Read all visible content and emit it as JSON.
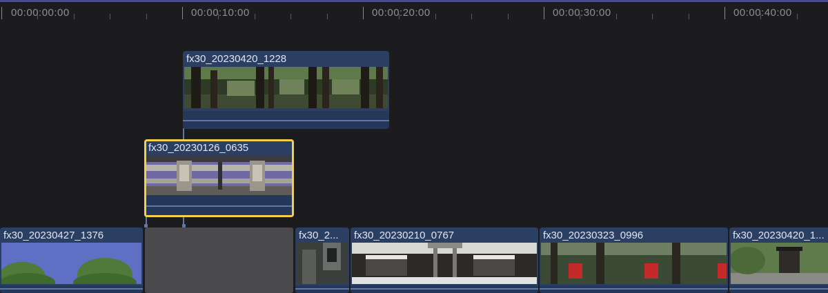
{
  "ruler": {
    "labels": [
      "00:00:00:00",
      "00:00:10:00",
      "00:00:20:00",
      "00:00:30:00",
      "00:00:40:00"
    ]
  },
  "clips": {
    "connected_top": {
      "name": "fx30_20230420_1228"
    },
    "connected_selected": {
      "name": "fx30_20230126_0635"
    },
    "primary": [
      {
        "name": "fx30_20230427_1376"
      },
      {
        "name": "fx30_2..."
      },
      {
        "name": "fx30_20230210_0767"
      },
      {
        "name": "fx30_20230323_0996"
      },
      {
        "name": "fx30_20230420_1..."
      }
    ]
  },
  "colors": {
    "clip_fill": "#2b3f63",
    "selection_border": "#f4cf4a",
    "background": "#1c1c1e"
  }
}
